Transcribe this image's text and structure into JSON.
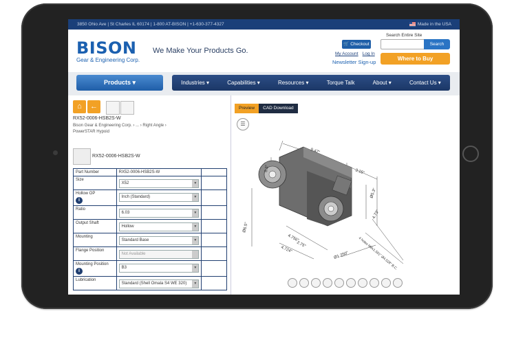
{
  "topbar": {
    "info": "3850 Ohio Ave  |  St Charles IL 60174  |  1-800 AT-BISON  |  +1-630-377-4327",
    "made_in": "Made in the USA"
  },
  "header": {
    "logo_word": "BISON",
    "logo_sub": "Gear & Engineering Corp.",
    "tagline": "We Make Your Products Go.",
    "checkout_label": "Checkout",
    "my_account": "My Account",
    "log_in": "Log In",
    "newsletter": "Newsletter Sign-up",
    "search_label": "Search Entire Site",
    "search_placeholder": "",
    "search_button": "Search",
    "where_to_buy": "Where to Buy"
  },
  "nav": {
    "products": "Products",
    "items": [
      "Industries",
      "Capabilities",
      "Resources",
      "Torque Talk",
      "About",
      "Contact Us"
    ]
  },
  "left": {
    "part_number_top": "RX52-0006-HSB2S-W",
    "breadcrumb": [
      "Bison Gear & Engineering Corp.",
      "...",
      "Right Angle",
      "PowerSTAR Hypoid"
    ],
    "part_label": "RX52-0006-HSB2S-W",
    "specs": [
      {
        "key": "Part Number",
        "value": "RX52-0006-HSB2S-W",
        "type": "text"
      },
      {
        "key": "Size",
        "value": "X52",
        "type": "select"
      },
      {
        "key": "Hollow OP",
        "value": "Inch (Standard)",
        "type": "select",
        "info": true
      },
      {
        "key": "Ratio",
        "value": "6.03",
        "type": "select"
      },
      {
        "key": "Output Shaft",
        "value": "Hollow",
        "type": "select"
      },
      {
        "key": "Mounting",
        "value": "Standard Base",
        "type": "select"
      },
      {
        "key": "Flange Position",
        "value": "Not Available",
        "type": "select-disabled"
      },
      {
        "key": "Mounting Position",
        "value": "B3",
        "type": "select",
        "info": true
      },
      {
        "key": "Lubrication",
        "value": "Standard (Shell Omala S4 WE 320)",
        "type": "select"
      }
    ]
  },
  "right": {
    "tab_preview": "Preview",
    "tab_cad": "CAD Download",
    "dims": [
      "9.47\"",
      "3.15\"",
      "4.73\"",
      "Ø6.5\"",
      "2.75\"",
      "4.724\"",
      "Ø1.250\"",
      "4 holes M8x1.591\" Ø4.528\" B.C.",
      "Ø5.3\"",
      "6.3\"",
      "4.756\""
    ]
  },
  "colors": {
    "brand_blue": "#1b60b0",
    "nav_dark": "#1b3766",
    "accent_orange": "#f2a125",
    "topbar": "#1a3f79"
  }
}
